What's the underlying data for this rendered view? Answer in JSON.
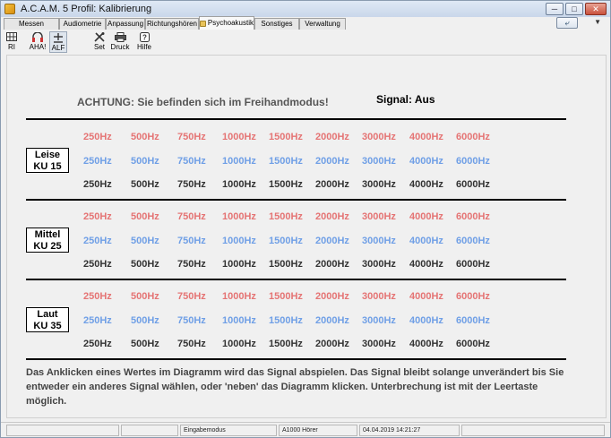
{
  "window": {
    "title": "A.C.A.M. 5  Profil: Kalibrierung",
    "controls": [
      "minimize",
      "maximize",
      "close"
    ]
  },
  "tabs": [
    {
      "label": "Messen",
      "active": false
    },
    {
      "label": "Audiometrie",
      "active": false
    },
    {
      "label": "Anpassung",
      "active": false
    },
    {
      "label": "Richtungshören",
      "active": false
    },
    {
      "label": "Psychoakustik",
      "active": true
    },
    {
      "label": "Sonstiges",
      "active": false
    },
    {
      "label": "Verwaltung",
      "active": false
    }
  ],
  "toolbar": {
    "items": [
      {
        "label": "RI",
        "icon": "grid-icon",
        "selected": false
      },
      {
        "label": "AHA!",
        "icon": "headphones-icon",
        "selected": false
      },
      {
        "label": "ALF",
        "icon": "plus-minus-icon",
        "selected": true
      },
      {
        "label": "Set",
        "icon": "tools-icon",
        "selected": false
      },
      {
        "label": "Druck",
        "icon": "printer-icon",
        "selected": false
      },
      {
        "label": "Hilfe",
        "icon": "help-icon",
        "selected": false
      }
    ]
  },
  "main": {
    "warning": "ACHTUNG: Sie befinden sich im Freihandmodus!",
    "signal": "Signal: Aus",
    "frequencies": [
      "250Hz",
      "500Hz",
      "750Hz",
      "1000Hz",
      "1500Hz",
      "2000Hz",
      "3000Hz",
      "4000Hz",
      "6000Hz"
    ],
    "row_colors": {
      "red": "#e57474",
      "blue": "#6f9fe6",
      "dark": "#333333"
    },
    "levels": [
      {
        "line1": "Leise",
        "line2": "KU 15"
      },
      {
        "line1": "Mittel",
        "line2": "KU 25"
      },
      {
        "line1": "Laut",
        "line2": "KU 35"
      }
    ],
    "info": "Das Anklicken eines Wertes im Diagramm wird das Signal abspielen. Das Signal bleibt solange unverändert bis Sie entweder ein anderes Signal wählen, oder 'neben' das Diagramm klicken. Unterbrechung ist mit der Leertaste möglich."
  },
  "statusbar": {
    "mode": "Eingabemodus",
    "device": "A1000 Hörer",
    "datetime": "04.04.2019 14:21:27"
  }
}
